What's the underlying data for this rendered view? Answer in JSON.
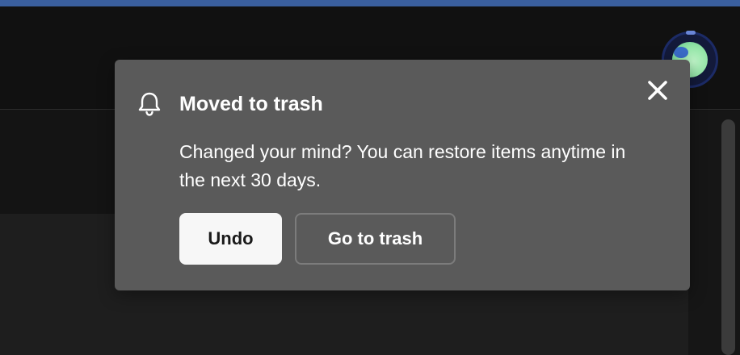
{
  "toast": {
    "icon": "bell-icon",
    "title": "Moved to trash",
    "message": "Changed your mind? You can restore items anytime in the next 30 days.",
    "undo_label": "Undo",
    "go_to_trash_label": "Go to trash",
    "close_icon": "close-icon"
  },
  "colors": {
    "toast_bg": "#5a5a5a",
    "page_bg": "#141414",
    "accent": "#3a5f9e",
    "primary_button_bg": "#f7f7f7"
  }
}
